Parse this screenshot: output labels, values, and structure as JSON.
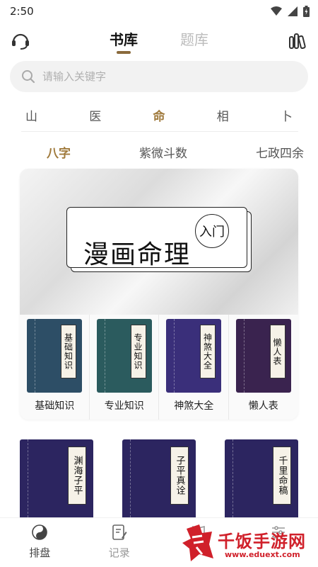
{
  "status": {
    "time": "2:50"
  },
  "header": {
    "tabs": [
      {
        "label": "书库",
        "active": true
      },
      {
        "label": "题库",
        "active": false
      }
    ]
  },
  "search": {
    "placeholder": "请输入关键字"
  },
  "categories": [
    "山",
    "医",
    "命",
    "相",
    "卜"
  ],
  "active_category": "命",
  "subcategories": [
    "八字",
    "紫微斗数",
    "七政四余"
  ],
  "active_subcategory": "八字",
  "banner": {
    "title": "漫画命理",
    "badge": "入门"
  },
  "featured_books": [
    {
      "name": "基础知识",
      "cover_text": "基础知识",
      "color": "#2d4e66"
    },
    {
      "name": "专业知识",
      "cover_text": "专业知识",
      "color": "#2b5b5e"
    },
    {
      "name": "神煞大全",
      "cover_text": "神煞大全",
      "color": "#3a2f7a"
    },
    {
      "name": "懒人表",
      "cover_text": "懒人表",
      "color": "#3a234f"
    }
  ],
  "more_books": [
    {
      "cover_text": "渊海子平"
    },
    {
      "cover_text": "子平真诠"
    },
    {
      "cover_text": "千里命稿"
    }
  ],
  "bottom_nav": [
    {
      "label": "排盘",
      "icon": "yin-yang-icon"
    },
    {
      "label": "记录",
      "icon": "edit-note-icon"
    },
    {
      "label": "",
      "icon": "book-icon"
    },
    {
      "label": "",
      "icon": "settings-sliders-icon"
    }
  ],
  "watermark": {
    "text": "千饭手游网",
    "url": "www.eduext.com"
  }
}
